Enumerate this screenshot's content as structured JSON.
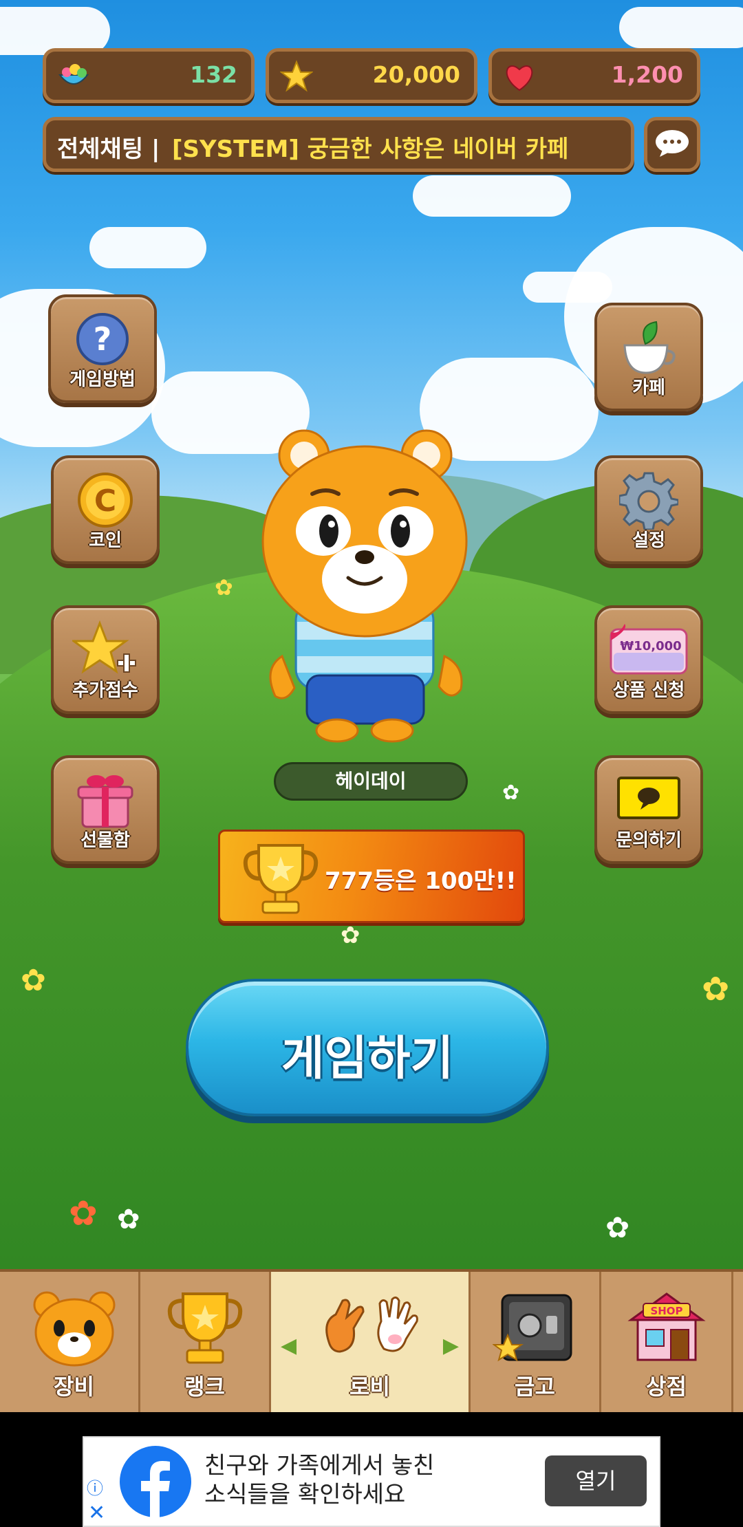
{
  "resources": [
    {
      "icon": "food-bowl-icon",
      "value": "132",
      "color": "#7be0a6"
    },
    {
      "icon": "star-icon",
      "value": "20,000",
      "color": "#ffd84a"
    },
    {
      "icon": "heart-icon",
      "value": "1,200",
      "color": "#ff8fb0"
    }
  ],
  "chat": {
    "label": "전체채팅 |",
    "message": "[SYSTEM] 궁금한 사항은 네이버 카페"
  },
  "left_menu": [
    {
      "label": "게임방법",
      "icon": "question-icon"
    },
    {
      "label": "코인",
      "icon": "coin-icon"
    },
    {
      "label": "추가점수",
      "icon": "star-plus-icon"
    },
    {
      "label": "선물함",
      "icon": "gift-box-icon"
    }
  ],
  "right_menu": [
    {
      "label": "카페",
      "icon": "tea-cup-icon"
    },
    {
      "label": "설정",
      "icon": "gear-icon"
    },
    {
      "label": "상품 신청",
      "icon": "gift-card-icon",
      "card_text": "₩10,000"
    },
    {
      "label": "문의하기",
      "icon": "speech-bubble-icon"
    }
  ],
  "character": {
    "name": "헤이데이"
  },
  "promo": {
    "text": "777등은 100만!!"
  },
  "play_button": {
    "label": "게임하기"
  },
  "nav": [
    {
      "label": "장비",
      "icon": "bear-face-icon"
    },
    {
      "label": "랭크",
      "icon": "trophy-icon"
    },
    {
      "label": "로비",
      "icon": "hands-icon",
      "active": true
    },
    {
      "label": "금고",
      "icon": "safe-icon"
    },
    {
      "label": "상점",
      "icon": "shop-icon",
      "sign": "SHOP"
    }
  ],
  "ad": {
    "text_line1": "친구와 가족에게서 놓친",
    "text_line2": "소식들을 확인하세요",
    "button": "열기"
  }
}
